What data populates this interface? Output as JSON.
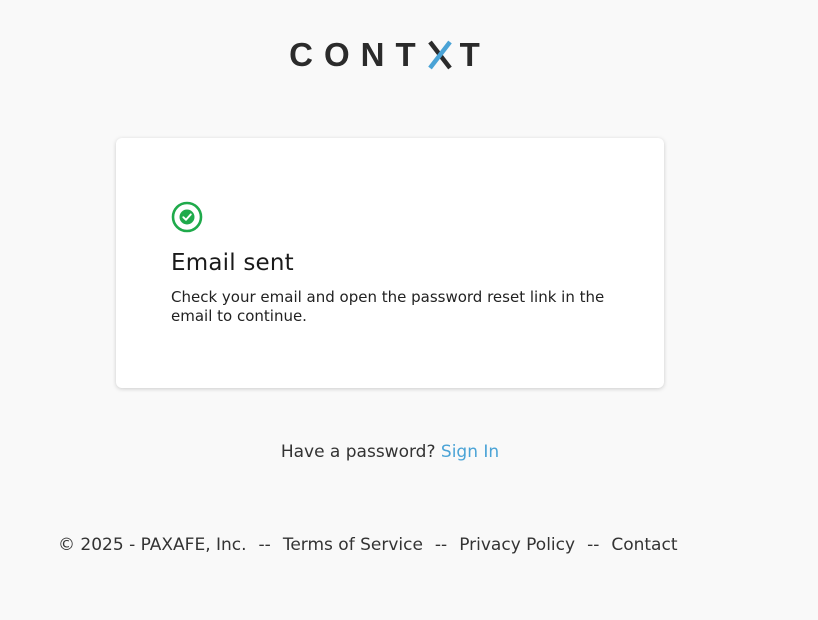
{
  "logo": {
    "text_before": "CONT",
    "accent_letter": "X",
    "text_after": "T"
  },
  "card": {
    "status_icon": "check-circle-icon",
    "title": "Email sent",
    "body": "Check your email and open the password reset link in the email to continue.",
    "success_color": "#1faa4b"
  },
  "signin": {
    "prompt": "Have a password?",
    "link_label": "Sign In",
    "link_color": "#4aa3d6"
  },
  "footer": {
    "copyright": "© 2025 - PAXAFE, Inc.",
    "separator": "--",
    "links": [
      "Terms of Service",
      "Privacy Policy",
      "Contact"
    ]
  },
  "colors": {
    "background": "#f9f9f9",
    "logo_accent": "#4aa3d6"
  }
}
